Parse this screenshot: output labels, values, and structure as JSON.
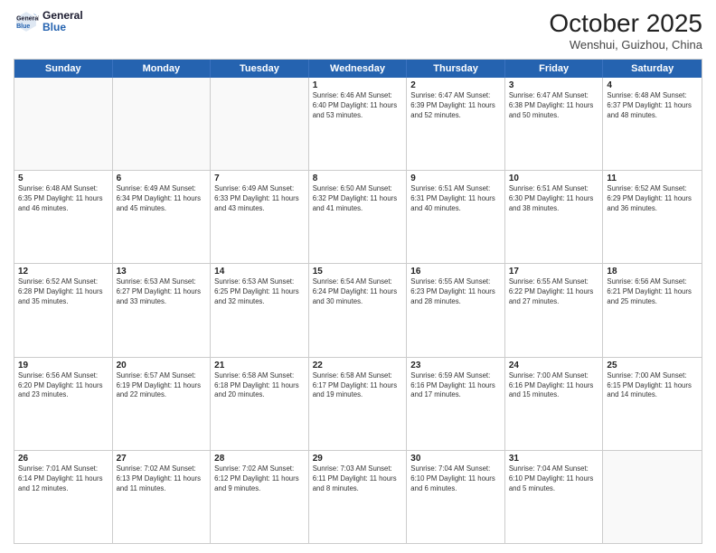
{
  "header": {
    "logo_general": "General",
    "logo_blue": "Blue",
    "month_title": "October 2025",
    "location": "Wenshui, Guizhou, China"
  },
  "weekdays": [
    "Sunday",
    "Monday",
    "Tuesday",
    "Wednesday",
    "Thursday",
    "Friday",
    "Saturday"
  ],
  "rows": [
    [
      {
        "day": "",
        "info": "",
        "empty": true
      },
      {
        "day": "",
        "info": "",
        "empty": true
      },
      {
        "day": "",
        "info": "",
        "empty": true
      },
      {
        "day": "1",
        "info": "Sunrise: 6:46 AM\nSunset: 6:40 PM\nDaylight: 11 hours\nand 53 minutes."
      },
      {
        "day": "2",
        "info": "Sunrise: 6:47 AM\nSunset: 6:39 PM\nDaylight: 11 hours\nand 52 minutes."
      },
      {
        "day": "3",
        "info": "Sunrise: 6:47 AM\nSunset: 6:38 PM\nDaylight: 11 hours\nand 50 minutes."
      },
      {
        "day": "4",
        "info": "Sunrise: 6:48 AM\nSunset: 6:37 PM\nDaylight: 11 hours\nand 48 minutes."
      }
    ],
    [
      {
        "day": "5",
        "info": "Sunrise: 6:48 AM\nSunset: 6:35 PM\nDaylight: 11 hours\nand 46 minutes."
      },
      {
        "day": "6",
        "info": "Sunrise: 6:49 AM\nSunset: 6:34 PM\nDaylight: 11 hours\nand 45 minutes."
      },
      {
        "day": "7",
        "info": "Sunrise: 6:49 AM\nSunset: 6:33 PM\nDaylight: 11 hours\nand 43 minutes."
      },
      {
        "day": "8",
        "info": "Sunrise: 6:50 AM\nSunset: 6:32 PM\nDaylight: 11 hours\nand 41 minutes."
      },
      {
        "day": "9",
        "info": "Sunrise: 6:51 AM\nSunset: 6:31 PM\nDaylight: 11 hours\nand 40 minutes."
      },
      {
        "day": "10",
        "info": "Sunrise: 6:51 AM\nSunset: 6:30 PM\nDaylight: 11 hours\nand 38 minutes."
      },
      {
        "day": "11",
        "info": "Sunrise: 6:52 AM\nSunset: 6:29 PM\nDaylight: 11 hours\nand 36 minutes."
      }
    ],
    [
      {
        "day": "12",
        "info": "Sunrise: 6:52 AM\nSunset: 6:28 PM\nDaylight: 11 hours\nand 35 minutes."
      },
      {
        "day": "13",
        "info": "Sunrise: 6:53 AM\nSunset: 6:27 PM\nDaylight: 11 hours\nand 33 minutes."
      },
      {
        "day": "14",
        "info": "Sunrise: 6:53 AM\nSunset: 6:25 PM\nDaylight: 11 hours\nand 32 minutes."
      },
      {
        "day": "15",
        "info": "Sunrise: 6:54 AM\nSunset: 6:24 PM\nDaylight: 11 hours\nand 30 minutes."
      },
      {
        "day": "16",
        "info": "Sunrise: 6:55 AM\nSunset: 6:23 PM\nDaylight: 11 hours\nand 28 minutes."
      },
      {
        "day": "17",
        "info": "Sunrise: 6:55 AM\nSunset: 6:22 PM\nDaylight: 11 hours\nand 27 minutes."
      },
      {
        "day": "18",
        "info": "Sunrise: 6:56 AM\nSunset: 6:21 PM\nDaylight: 11 hours\nand 25 minutes."
      }
    ],
    [
      {
        "day": "19",
        "info": "Sunrise: 6:56 AM\nSunset: 6:20 PM\nDaylight: 11 hours\nand 23 minutes."
      },
      {
        "day": "20",
        "info": "Sunrise: 6:57 AM\nSunset: 6:19 PM\nDaylight: 11 hours\nand 22 minutes."
      },
      {
        "day": "21",
        "info": "Sunrise: 6:58 AM\nSunset: 6:18 PM\nDaylight: 11 hours\nand 20 minutes."
      },
      {
        "day": "22",
        "info": "Sunrise: 6:58 AM\nSunset: 6:17 PM\nDaylight: 11 hours\nand 19 minutes."
      },
      {
        "day": "23",
        "info": "Sunrise: 6:59 AM\nSunset: 6:16 PM\nDaylight: 11 hours\nand 17 minutes."
      },
      {
        "day": "24",
        "info": "Sunrise: 7:00 AM\nSunset: 6:16 PM\nDaylight: 11 hours\nand 15 minutes."
      },
      {
        "day": "25",
        "info": "Sunrise: 7:00 AM\nSunset: 6:15 PM\nDaylight: 11 hours\nand 14 minutes."
      }
    ],
    [
      {
        "day": "26",
        "info": "Sunrise: 7:01 AM\nSunset: 6:14 PM\nDaylight: 11 hours\nand 12 minutes."
      },
      {
        "day": "27",
        "info": "Sunrise: 7:02 AM\nSunset: 6:13 PM\nDaylight: 11 hours\nand 11 minutes."
      },
      {
        "day": "28",
        "info": "Sunrise: 7:02 AM\nSunset: 6:12 PM\nDaylight: 11 hours\nand 9 minutes."
      },
      {
        "day": "29",
        "info": "Sunrise: 7:03 AM\nSunset: 6:11 PM\nDaylight: 11 hours\nand 8 minutes."
      },
      {
        "day": "30",
        "info": "Sunrise: 7:04 AM\nSunset: 6:10 PM\nDaylight: 11 hours\nand 6 minutes."
      },
      {
        "day": "31",
        "info": "Sunrise: 7:04 AM\nSunset: 6:10 PM\nDaylight: 11 hours\nand 5 minutes."
      },
      {
        "day": "",
        "info": "",
        "empty": true
      }
    ]
  ]
}
